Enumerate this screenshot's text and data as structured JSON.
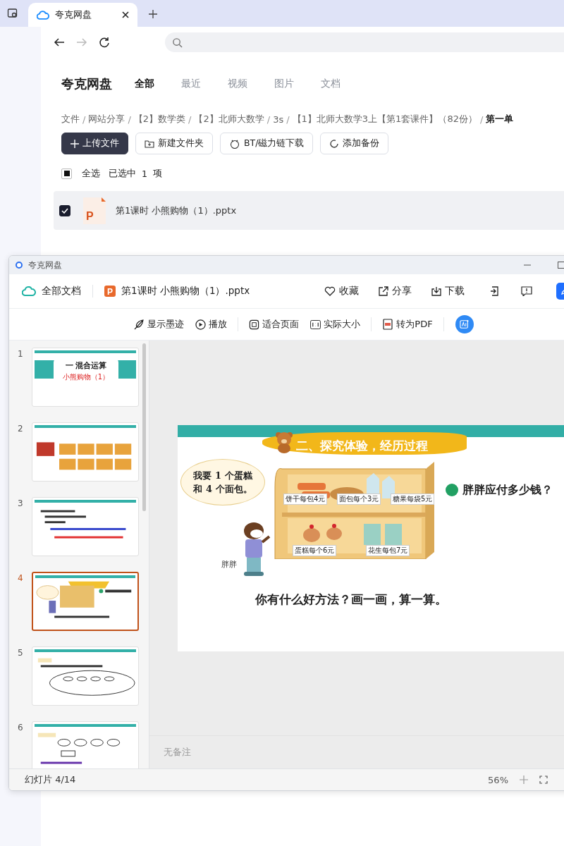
{
  "browser": {
    "tabs": [
      {
        "title": "夸克网盘",
        "selected": true
      }
    ]
  },
  "app": {
    "logo": "夸克网盘",
    "nav": [
      {
        "label": "全部",
        "selected": true
      },
      {
        "label": "最近",
        "selected": false
      },
      {
        "label": "视频",
        "selected": false
      },
      {
        "label": "图片",
        "selected": false
      },
      {
        "label": "文档",
        "selected": false
      }
    ],
    "breadcrumb_separator": "/",
    "breadcrumb": [
      "文件",
      "网站分享",
      "【2】数学类",
      "【2】北师大数学",
      "3s",
      "【1】北师大数学3上【第1套课件】（82份）",
      "第一单"
    ],
    "actions": [
      {
        "label": "上传文件",
        "kind": "upload"
      },
      {
        "label": "新建文件夹",
        "kind": "folder"
      },
      {
        "label": "BT/磁力链下载",
        "kind": "bt"
      },
      {
        "label": "添加备份",
        "kind": "backup"
      }
    ],
    "selection": {
      "select_all": "全选",
      "partial": true,
      "selected_label": "已选中",
      "count": "1",
      "unit": "项"
    },
    "files": [
      {
        "name": "第1课时 小熊购物（1）.pptx",
        "icon_letter": "P",
        "checked": true
      }
    ]
  },
  "viewer": {
    "title": "夸克网盘",
    "root": "全部文档",
    "file": "第1课时 小熊购物（1）.pptx",
    "file_icon_letter": "P",
    "actions": [
      {
        "label": "收藏",
        "kind": "heart"
      },
      {
        "label": "分享",
        "kind": "share"
      },
      {
        "label": "下载",
        "kind": "download"
      }
    ],
    "toolbar": [
      {
        "label": "显示墨迹",
        "kind": "ink"
      },
      {
        "label": "播放",
        "kind": "play"
      },
      {
        "label": "适合页面",
        "kind": "fit"
      },
      {
        "label": "实际大小",
        "kind": "actual"
      },
      {
        "label": "转为PDF",
        "kind": "pdf"
      }
    ],
    "thumbnails": [
      {
        "number": "1",
        "kind": "cover",
        "title": "一 混合运算",
        "subtitle": "小熊购物（1）",
        "selected": false
      },
      {
        "number": "2",
        "kind": "train",
        "selected": false
      },
      {
        "number": "3",
        "kind": "text",
        "selected": false
      },
      {
        "number": "4",
        "kind": "shop",
        "selected": true
      },
      {
        "number": "5",
        "kind": "diagram",
        "selected": false
      },
      {
        "number": "6",
        "kind": "steps",
        "selected": false
      }
    ],
    "slide": {
      "title": "二、探究体验，经历过程",
      "speech": [
        "我要 1 个蛋糕",
        "和 4 个面包。"
      ],
      "character": "胖胖",
      "shelf_labels": [
        "饼干每包4元",
        "面包每个3元",
        "糖果每袋5元",
        "蛋糕每个6元",
        "花生每包7元"
      ],
      "question": "胖胖应付多少钱？",
      "prompt": "你有什么好方法？画一画，算一算。"
    },
    "notes_placeholder": "无备注",
    "status": "幻灯片 4/14",
    "zoom": "56%"
  }
}
